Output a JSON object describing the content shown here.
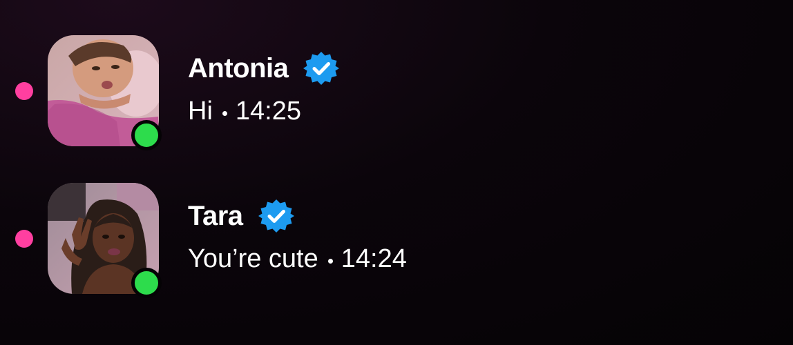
{
  "chats": [
    {
      "name": "Antonia",
      "verified": true,
      "message": "Hi",
      "time": "14:25",
      "unread": true,
      "online": true,
      "avatar": "photo-woman-pink-top"
    },
    {
      "name": "Tara",
      "verified": true,
      "message": "You’re cute",
      "time": "14:24",
      "unread": true,
      "online": true,
      "avatar": "photo-woman-peace-sign"
    }
  ],
  "colors": {
    "unread": "#ff3fa0",
    "online": "#2ddc4c",
    "verified": "#1d9bf0",
    "text": "#ffffff"
  }
}
